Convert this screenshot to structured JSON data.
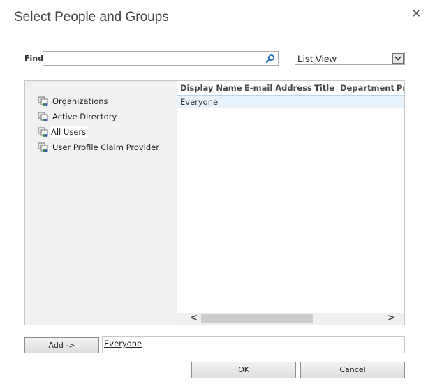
{
  "dialog": {
    "title": "Select People and Groups",
    "close_icon": "close-icon"
  },
  "find": {
    "label": "Find",
    "value": "",
    "placeholder": "",
    "search_icon": "search-icon"
  },
  "view_select": {
    "selected": "List View"
  },
  "tree": {
    "items": [
      {
        "label": "Organizations",
        "icon": "directory-group-icon",
        "selected": false
      },
      {
        "label": "Active Directory",
        "icon": "directory-group-icon",
        "selected": false
      },
      {
        "label": "All Users",
        "icon": "directory-group-icon",
        "selected": true
      },
      {
        "label": "User Profile Claim Provider",
        "icon": "directory-group-icon",
        "selected": false
      }
    ]
  },
  "results": {
    "columns": [
      "Display Name",
      "E-mail Address",
      "Title",
      "Department",
      "Pr"
    ],
    "rows": [
      {
        "display_name": "Everyone",
        "email": "",
        "title": "",
        "department": ""
      }
    ]
  },
  "add": {
    "button_label": "Add ->",
    "selected_value": "Everyone"
  },
  "footer": {
    "ok_label": "OK",
    "cancel_label": "Cancel"
  }
}
